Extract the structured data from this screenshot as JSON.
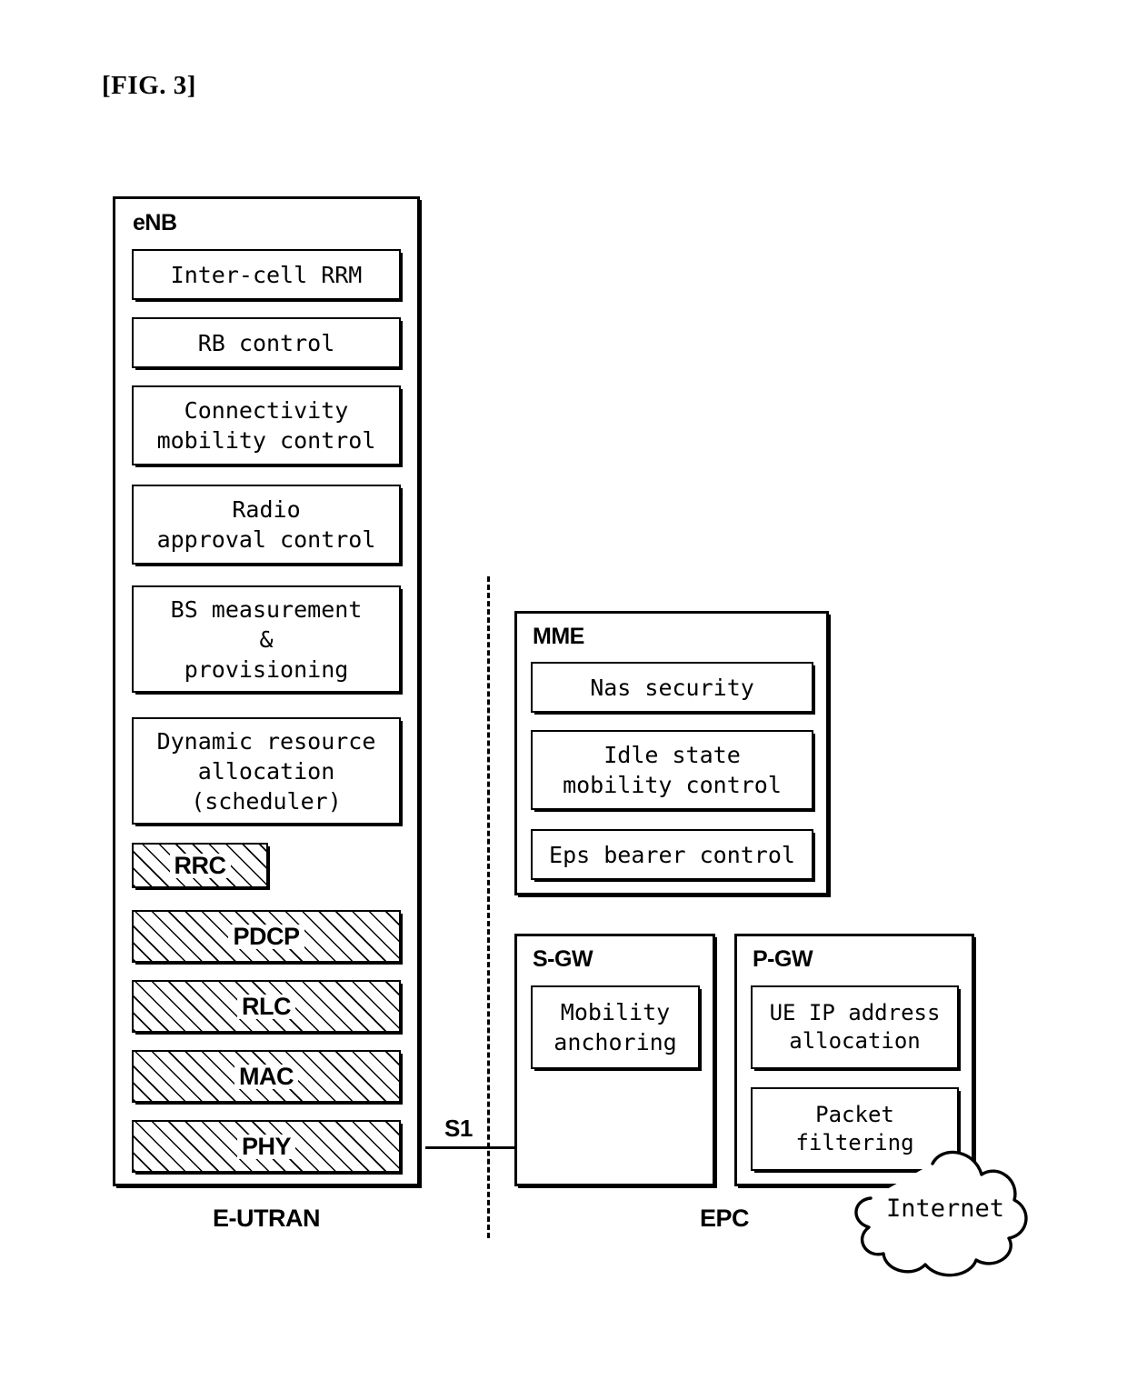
{
  "figure": {
    "title": "[FIG. 3]"
  },
  "enb": {
    "label": "eNB",
    "functions": [
      "Inter-cell RRM",
      "RB control",
      "Connectivity\nmobility control",
      "Radio\napproval control",
      "BS measurement\n&\nprovisioning",
      "Dynamic resource\nallocation\n(scheduler)"
    ],
    "protocol_layers": [
      "RRC",
      "PDCP",
      "RLC",
      "MAC",
      "PHY"
    ]
  },
  "mme": {
    "label": "MME",
    "functions": [
      "Nas security",
      "Idle state\nmobility control",
      "Eps bearer control"
    ]
  },
  "sgw": {
    "label": "S-GW",
    "functions": [
      "Mobility\nanchoring"
    ]
  },
  "pgw": {
    "label": "P-GW",
    "functions": [
      "UE IP address\nallocation",
      "Packet\nfiltering"
    ]
  },
  "interface": {
    "s1_label": "S1"
  },
  "domains": {
    "left": "E-UTRAN",
    "right": "EPC"
  },
  "internet": {
    "label": "Internet"
  },
  "colors": {
    "stroke": "#000000",
    "background": "#ffffff"
  }
}
